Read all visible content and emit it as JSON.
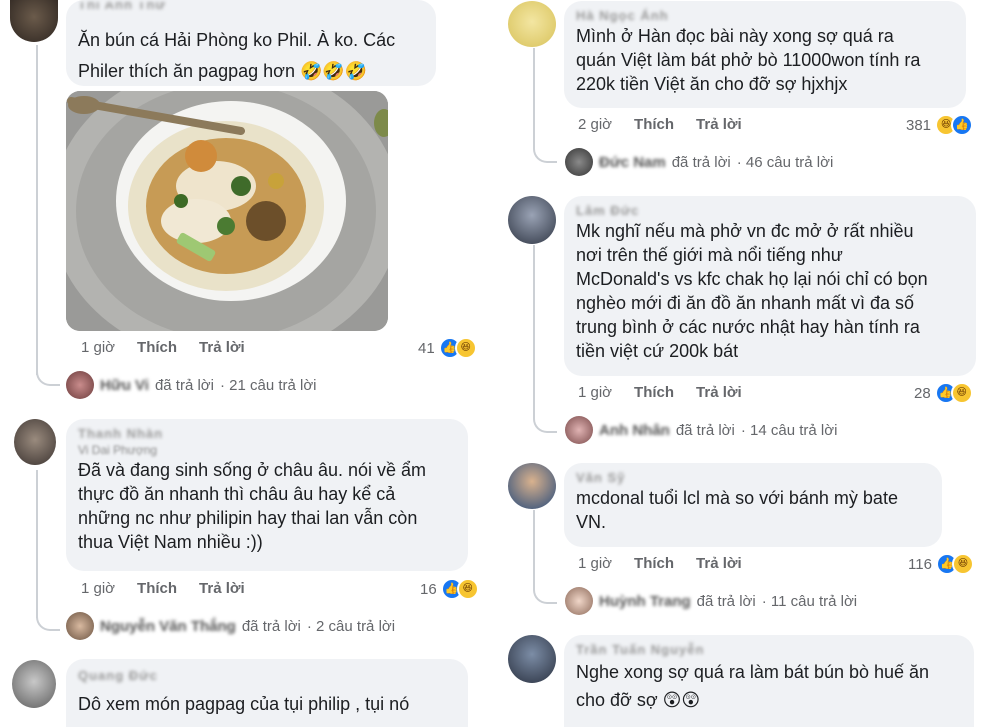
{
  "comments": [
    {
      "author": "Thì Anh Thư",
      "text": [
        "Ăn bún cá Hải Phòng ko Phil. À ko. Các",
        "Philer thích ăn pagpag hơn 🤣🤣🤣"
      ],
      "time": "1 giờ",
      "like": "Thích",
      "reply": "Trả lời",
      "reactions": "41",
      "replies": {
        "who": "Hữu Vi",
        "label": "đã trả lời",
        "count": "· 21 câu trả lời"
      }
    },
    {
      "author": "Thanh Nhàn",
      "author_sub": "Vi Dai Phượng",
      "text": [
        "Đã và đang sinh sống ở châu âu. nói về ẩm",
        "thực đồ ăn nhanh thì châu âu hay kể cả",
        "những nc như philipin hay thai lan vẫn còn",
        "thua Việt Nam nhiều :))"
      ],
      "time": "1 giờ",
      "like": "Thích",
      "reply": "Trả lời",
      "reactions": "16",
      "replies": {
        "who": "Nguyễn Văn Thắng",
        "label": "đã trả lời",
        "count": "· 2 câu trả lời"
      }
    },
    {
      "author": "Quang Đức",
      "text": [
        "Dô xem món pagpag của tụi philip , tụi nó"
      ]
    },
    {
      "author": "Hà Ngọc Ánh",
      "text": [
        "Mình ở Hàn đọc bài này xong sợ quá ra",
        "quán Việt làm bát phở bò 11000won tính ra",
        "220k tiền Việt ăn cho đỡ sợ hjxhjx"
      ],
      "time": "2 giờ",
      "like": "Thích",
      "reply": "Trả lời",
      "reactions": "381",
      "replies": {
        "who": "Đức Nam",
        "label": "đã trả lời",
        "count": "· 46 câu trả lời"
      }
    },
    {
      "author": "Lâm Đức",
      "text": [
        "Mk nghĩ nếu mà phở vn đc mở ở rất nhiều",
        "nơi trên thế giới mà nổi tiếng như",
        "McDonald's vs kfc chak họ lại nói chỉ có bọn",
        "nghèo mới đi ăn đồ ăn nhanh mất vì đa số",
        "trung bình ở các nước nhật hay hàn tính ra",
        "tiền việt cứ 200k bát"
      ],
      "time": "1 giờ",
      "like": "Thích",
      "reply": "Trả lời",
      "reactions": "28",
      "replies": {
        "who": "Anh Nhân",
        "label": "đã trả lời",
        "count": "· 14 câu trả lời"
      }
    },
    {
      "author": "Văn Sỹ",
      "text": [
        "mcdonal tuổi lcl mà so với bánh mỳ bate",
        "VN."
      ],
      "time": "1 giờ",
      "like": "Thích",
      "reply": "Trả lời",
      "reactions": "116",
      "replies": {
        "who": "Huỳnh Trang",
        "label": "đã trả lời",
        "count": "· 11 câu trả lời"
      }
    },
    {
      "author": "Trần Tuấn Nguyễn",
      "text": [
        "Nghe xong sợ quá ra làm bát bún bò huế ăn",
        "cho đỡ sợ 😲😲"
      ]
    }
  ],
  "colors": {
    "bubble": "#f0f2f5",
    "like_blue": "#1877f2",
    "haha_yellow": "#f7c531",
    "meta_gray": "#65676b"
  },
  "icons": {
    "like": "like-icon",
    "haha": "haha-icon"
  }
}
